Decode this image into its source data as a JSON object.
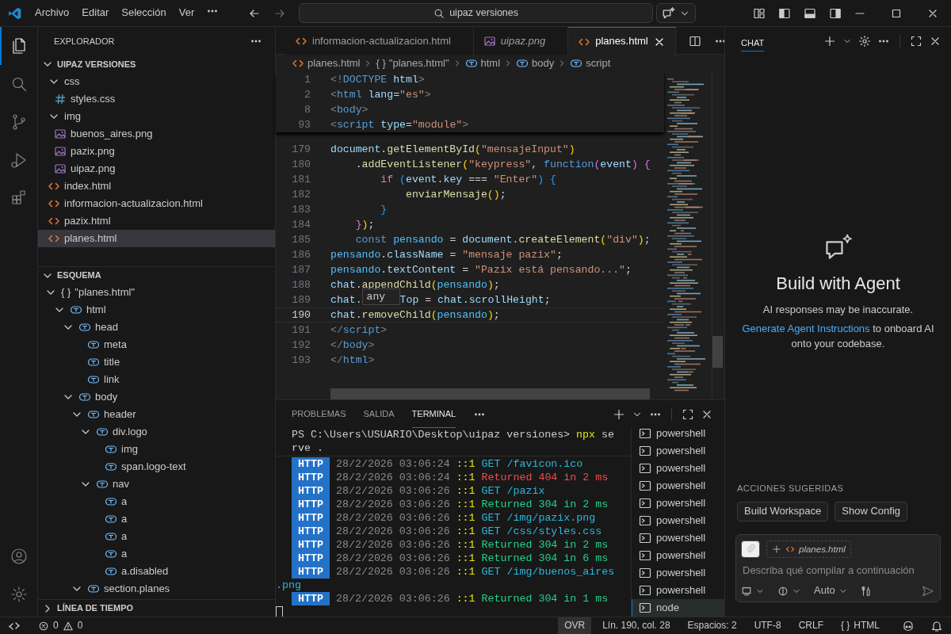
{
  "title_bar": {
    "menu": [
      "Archivo",
      "Editar",
      "Selección",
      "Ver"
    ],
    "search": {
      "value": "uipaz versiones"
    }
  },
  "activity_bar": {
    "top": [
      {
        "kind": "files",
        "selected": true
      },
      {
        "kind": "search",
        "selected": false
      },
      {
        "kind": "source-control",
        "selected": false
      },
      {
        "kind": "run",
        "selected": false
      },
      {
        "kind": "extensions",
        "selected": false
      }
    ],
    "bottom": [
      {
        "kind": "account"
      },
      {
        "kind": "settings"
      }
    ]
  },
  "explorer": {
    "title": "EXPLORADOR",
    "folder": {
      "name": "UIPAZ VERSIONES",
      "expanded": true
    },
    "tree": [
      {
        "name": "css",
        "kind": "folder",
        "expanded": true,
        "selected": false,
        "children": [
          {
            "name": "styles.css",
            "kind": "css",
            "selected": false
          }
        ]
      },
      {
        "name": "img",
        "kind": "folder",
        "expanded": true,
        "selected": false,
        "children": [
          {
            "name": "buenos_aires.png",
            "kind": "image",
            "selected": false
          },
          {
            "name": "pazix.png",
            "kind": "image",
            "selected": false
          },
          {
            "name": "uipaz.png",
            "kind": "image",
            "selected": false
          }
        ]
      },
      {
        "name": "index.html",
        "kind": "html",
        "selected": false
      },
      {
        "name": "informacion-actualizacion.html",
        "kind": "html",
        "selected": false
      },
      {
        "name": "pazix.html",
        "kind": "html",
        "selected": false
      },
      {
        "name": "planes.html",
        "kind": "html",
        "selected": true
      }
    ]
  },
  "outline": {
    "title": "ESQUEMA",
    "expanded": true,
    "tree": [
      {
        "label": "\"planes.html\"",
        "kind": "object",
        "symbol": "{ }",
        "expanded": true,
        "children": [
          {
            "label": "html",
            "kind": "element",
            "expanded": true,
            "children": [
              {
                "label": "head",
                "kind": "element",
                "expanded": true,
                "children": [
                  {
                    "label": "meta",
                    "kind": "element"
                  },
                  {
                    "label": "title",
                    "kind": "element"
                  },
                  {
                    "label": "link",
                    "kind": "element"
                  }
                ]
              },
              {
                "label": "body",
                "kind": "element",
                "expanded": true,
                "children": [
                  {
                    "label": "header",
                    "kind": "element",
                    "expanded": true,
                    "children": [
                      {
                        "label": "div.logo",
                        "kind": "element",
                        "expanded": true,
                        "children": [
                          {
                            "label": "img",
                            "kind": "element"
                          },
                          {
                            "label": "span.logo-text",
                            "kind": "element"
                          }
                        ]
                      },
                      {
                        "label": "nav",
                        "kind": "element",
                        "expanded": true,
                        "children": [
                          {
                            "label": "a",
                            "kind": "element"
                          },
                          {
                            "label": "a",
                            "kind": "element"
                          },
                          {
                            "label": "a",
                            "kind": "element"
                          },
                          {
                            "label": "a",
                            "kind": "element"
                          },
                          {
                            "label": "a.disabled",
                            "kind": "element"
                          }
                        ]
                      }
                    ]
                  },
                  {
                    "label": "section.planes",
                    "kind": "element",
                    "expanded": true
                  }
                ]
              }
            ]
          }
        ]
      }
    ]
  },
  "timeline": {
    "title": "LÍNEA DE TIEMPO",
    "expanded": false
  },
  "tabs": [
    {
      "label": "informacion-actualizacion.html",
      "kind": "html",
      "preview": false,
      "selected": false
    },
    {
      "label": "uipaz.png",
      "kind": "image",
      "preview": true,
      "selected": false
    },
    {
      "label": "planes.html",
      "kind": "html",
      "preview": false,
      "selected": true
    }
  ],
  "breadcrumbs": [
    {
      "label": "planes.html",
      "kind": "html"
    },
    {
      "label": "\"planes.html\"",
      "kind": "object",
      "symbol": "{ }"
    },
    {
      "label": "html",
      "kind": "element"
    },
    {
      "label": "body",
      "kind": "element"
    },
    {
      "label": "script",
      "kind": "element"
    }
  ],
  "sticky_lines": [
    {
      "number": "1",
      "tokens": [
        {
          "kind": "t",
          "text": "<!"
        },
        {
          "kind": "tg",
          "text": "DOCTYPE"
        },
        {
          "kind": "at",
          "text": " html"
        },
        {
          "kind": "t",
          "text": ">"
        }
      ]
    },
    {
      "number": "2",
      "tokens": [
        {
          "kind": "t",
          "text": "<"
        },
        {
          "kind": "tg",
          "text": "html"
        },
        {
          "kind": "at",
          "text": " lang"
        },
        {
          "kind": "p",
          "text": "="
        },
        {
          "kind": "s",
          "text": "\"es\""
        },
        {
          "kind": "t",
          "text": ">"
        }
      ]
    },
    {
      "number": "8",
      "tokens": [
        {
          "kind": "t",
          "text": "<"
        },
        {
          "kind": "tg",
          "text": "body"
        },
        {
          "kind": "t",
          "text": ">"
        }
      ]
    },
    {
      "number": "93",
      "tokens": [
        {
          "kind": "t",
          "text": "<"
        },
        {
          "kind": "tg",
          "text": "script"
        },
        {
          "kind": "at",
          "text": " type"
        },
        {
          "kind": "p",
          "text": "="
        },
        {
          "kind": "s",
          "text": "\"module\""
        },
        {
          "kind": "t",
          "text": ">"
        }
      ]
    }
  ],
  "code_lines": [
    {
      "number": "179",
      "current": false,
      "tokens": [
        {
          "kind": "v",
          "text": "document"
        },
        {
          "kind": "p",
          "text": "."
        },
        {
          "kind": "f",
          "text": "getElementById"
        },
        {
          "kind": "b1",
          "text": "("
        },
        {
          "kind": "s",
          "text": "\"mensajeInput\""
        },
        {
          "kind": "b1",
          "text": ")"
        }
      ]
    },
    {
      "number": "180",
      "current": false,
      "tokens": [
        {
          "kind": "p",
          "text": "    ."
        },
        {
          "kind": "f",
          "text": "addEventListener"
        },
        {
          "kind": "b1",
          "text": "("
        },
        {
          "kind": "s",
          "text": "\"keypress\""
        },
        {
          "kind": "p",
          "text": ", "
        },
        {
          "kind": "k",
          "text": "function"
        },
        {
          "kind": "b2",
          "text": "("
        },
        {
          "kind": "v",
          "text": "event"
        },
        {
          "kind": "b2",
          "text": ")"
        },
        {
          "kind": "b2",
          "text": " {"
        }
      ]
    },
    {
      "number": "181",
      "current": false,
      "tokens": [
        {
          "kind": "kc",
          "text": "        if"
        },
        {
          "kind": "b3",
          "text": " ("
        },
        {
          "kind": "v",
          "text": "event"
        },
        {
          "kind": "p",
          "text": "."
        },
        {
          "kind": "v",
          "text": "key"
        },
        {
          "kind": "p",
          "text": " === "
        },
        {
          "kind": "s",
          "text": "\"Enter\""
        },
        {
          "kind": "b3",
          "text": ")"
        },
        {
          "kind": "b3",
          "text": " {"
        }
      ]
    },
    {
      "number": "182",
      "current": false,
      "tokens": [
        {
          "kind": "f",
          "text": "            enviarMensaje"
        },
        {
          "kind": "b1",
          "text": "()"
        },
        {
          "kind": "p",
          "text": ";"
        }
      ]
    },
    {
      "number": "183",
      "current": false,
      "tokens": [
        {
          "kind": "b3",
          "text": "        }"
        }
      ]
    },
    {
      "number": "184",
      "current": false,
      "tokens": [
        {
          "kind": "b2",
          "text": "    }"
        },
        {
          "kind": "b1",
          "text": ")"
        },
        {
          "kind": "p",
          "text": ";"
        }
      ]
    },
    {
      "number": "185",
      "current": false,
      "tokens": [
        {
          "kind": "k",
          "text": "    const"
        },
        {
          "kind": "c",
          "text": " pensando"
        },
        {
          "kind": "p",
          "text": " = "
        },
        {
          "kind": "v",
          "text": "document"
        },
        {
          "kind": "p",
          "text": "."
        },
        {
          "kind": "f",
          "text": "createElement"
        },
        {
          "kind": "b1",
          "text": "("
        },
        {
          "kind": "s",
          "text": "\"div\""
        },
        {
          "kind": "b1",
          "text": ")"
        },
        {
          "kind": "p",
          "text": ";"
        }
      ]
    },
    {
      "number": "186",
      "current": false,
      "tokens": [
        {
          "kind": "c",
          "text": "pensando"
        },
        {
          "kind": "p",
          "text": "."
        },
        {
          "kind": "v",
          "text": "className"
        },
        {
          "kind": "p",
          "text": " = "
        },
        {
          "kind": "s",
          "text": "\"mensaje pazix\""
        },
        {
          "kind": "p",
          "text": ";"
        }
      ]
    },
    {
      "number": "187",
      "current": false,
      "tokens": [
        {
          "kind": "c",
          "text": "pensando"
        },
        {
          "kind": "p",
          "text": "."
        },
        {
          "kind": "v",
          "text": "textContent"
        },
        {
          "kind": "p",
          "text": " = "
        },
        {
          "kind": "s",
          "text": "\"Pazix está pensando...\""
        },
        {
          "kind": "p",
          "text": ";"
        }
      ]
    },
    {
      "number": "188",
      "current": false,
      "tokens": [
        {
          "kind": "v",
          "text": "chat"
        },
        {
          "kind": "p",
          "text": "."
        },
        {
          "kind": "f",
          "text": "appendChild"
        },
        {
          "kind": "b1",
          "text": "("
        },
        {
          "kind": "c",
          "text": "pensando"
        },
        {
          "kind": "b1",
          "text": ")"
        },
        {
          "kind": "p",
          "text": ";"
        }
      ]
    },
    {
      "number": "189",
      "current": false,
      "tokens_before": [
        {
          "kind": "v",
          "text": "chat"
        },
        {
          "kind": "p",
          "text": "."
        }
      ],
      "hover_tooltip": "any",
      "tokens": [
        {
          "kind": "v",
          "text": "Top"
        },
        {
          "kind": "p",
          "text": " = "
        },
        {
          "kind": "v",
          "text": "chat"
        },
        {
          "kind": "p",
          "text": "."
        },
        {
          "kind": "v",
          "text": "scrollHeight"
        },
        {
          "kind": "p",
          "text": ";"
        }
      ]
    },
    {
      "number": "190",
      "current": true,
      "tokens": [
        {
          "kind": "v",
          "text": "chat"
        },
        {
          "kind": "p",
          "text": "."
        },
        {
          "kind": "f",
          "text": "removeChild"
        },
        {
          "kind": "b1",
          "text": "("
        },
        {
          "kind": "c",
          "text": "pensando"
        },
        {
          "kind": "b1",
          "text": ")"
        },
        {
          "kind": "p",
          "text": ";"
        }
      ]
    },
    {
      "number": "191",
      "current": false,
      "tokens": [
        {
          "kind": "t",
          "text": "</"
        },
        {
          "kind": "tg",
          "text": "script"
        },
        {
          "kind": "t",
          "text": ">"
        }
      ]
    },
    {
      "number": "192",
      "current": false,
      "tokens": [
        {
          "kind": "t",
          "text": "</"
        },
        {
          "kind": "tg",
          "text": "body"
        },
        {
          "kind": "t",
          "text": ">"
        }
      ]
    },
    {
      "number": "193",
      "current": false,
      "tokens": [
        {
          "kind": "t",
          "text": "</"
        },
        {
          "kind": "tg",
          "text": "html"
        },
        {
          "kind": "t",
          "text": ">"
        }
      ]
    }
  ],
  "panel": {
    "tabs": [
      {
        "label": "PROBLEMAS",
        "selected": false
      },
      {
        "label": "SALIDA",
        "selected": false
      },
      {
        "label": "TERMINAL",
        "selected": true
      }
    ],
    "command_lines": [
      [
        {
          "kind": "prompt",
          "text": "PS C:\\Users\\USUARIO\\Desktop\\uipaz versiones> "
        },
        {
          "kind": "program",
          "text": "npx"
        },
        {
          "kind": "arg",
          "text": " se"
        }
      ],
      [
        {
          "kind": "arg",
          "text": "rve ."
        }
      ]
    ],
    "logs": [
      {
        "badge": "HTTP",
        "time": "28/2/2026 03:06:24",
        "addr": "::1",
        "message": "GET /favicon.ico",
        "kind": "request"
      },
      {
        "badge": "HTTP",
        "time": "28/2/2026 03:06:24",
        "addr": "::1",
        "message": "Returned 404 in 2 ms",
        "kind": "error"
      },
      {
        "badge": "HTTP",
        "time": "28/2/2026 03:06:26",
        "addr": "::1",
        "message": "GET /pazix",
        "kind": "request"
      },
      {
        "badge": "HTTP",
        "time": "28/2/2026 03:06:26",
        "addr": "::1",
        "message": "Returned 304 in 2 ms",
        "kind": "success"
      },
      {
        "badge": "HTTP",
        "time": "28/2/2026 03:06:26",
        "addr": "::1",
        "message": "GET /img/pazix.png",
        "kind": "request"
      },
      {
        "badge": "HTTP",
        "time": "28/2/2026 03:06:26",
        "addr": "::1",
        "message": "GET /css/styles.css",
        "kind": "request"
      },
      {
        "badge": "HTTP",
        "time": "28/2/2026 03:06:26",
        "addr": "::1",
        "message": "Returned 304 in 2 ms",
        "kind": "success"
      },
      {
        "badge": "HTTP",
        "time": "28/2/2026 03:06:26",
        "addr": "::1",
        "message": "Returned 304 in 6 ms",
        "kind": "success"
      },
      {
        "badge": "HTTP",
        "time": "28/2/2026 03:06:26",
        "addr": "::1",
        "message": "GET /img/buenos_aires",
        "continuation": ".png",
        "kind": "request"
      },
      {
        "badge": "HTTP",
        "time": "28/2/2026 03:06:26",
        "addr": "::1",
        "message": "Returned 304 in 1 ms",
        "kind": "success"
      }
    ],
    "terminals": [
      {
        "label": "powershell",
        "selected": false
      },
      {
        "label": "powershell",
        "selected": false
      },
      {
        "label": "powershell",
        "selected": false
      },
      {
        "label": "powershell",
        "selected": false
      },
      {
        "label": "powershell",
        "selected": false
      },
      {
        "label": "powershell",
        "selected": false
      },
      {
        "label": "powershell",
        "selected": false
      },
      {
        "label": "powershell",
        "selected": false
      },
      {
        "label": "powershell",
        "selected": false
      },
      {
        "label": "powershell",
        "selected": false
      },
      {
        "label": "node",
        "selected": true
      }
    ]
  },
  "chat": {
    "tab": "CHAT",
    "heading": "Build with Agent",
    "note": "AI responses may be inaccurate.",
    "onboard": {
      "link": "Generate Agent Instructions",
      "text": "to onboard AI onto your codebase."
    },
    "suggestions_title": "ACCIONES SUGERIDAS",
    "suggestions": [
      "Build Workspace",
      "Show Config"
    ],
    "input": {
      "context_file": "planes.html",
      "placeholder": "Describa qué compilar a continuación",
      "mode": "Auto"
    }
  },
  "status_bar": {
    "errors": "0",
    "warnings": "0",
    "items": [
      {
        "label": "OVR",
        "highlighted": true
      },
      {
        "label": "Lín. 190, col. 28",
        "highlighted": false
      },
      {
        "label": "Espacios: 2",
        "highlighted": false
      },
      {
        "label": "UTF-8",
        "highlighted": false
      },
      {
        "label": "CRLF",
        "highlighted": false
      },
      {
        "symbol": "{ }",
        "label": "HTML",
        "highlighted": false
      }
    ]
  }
}
